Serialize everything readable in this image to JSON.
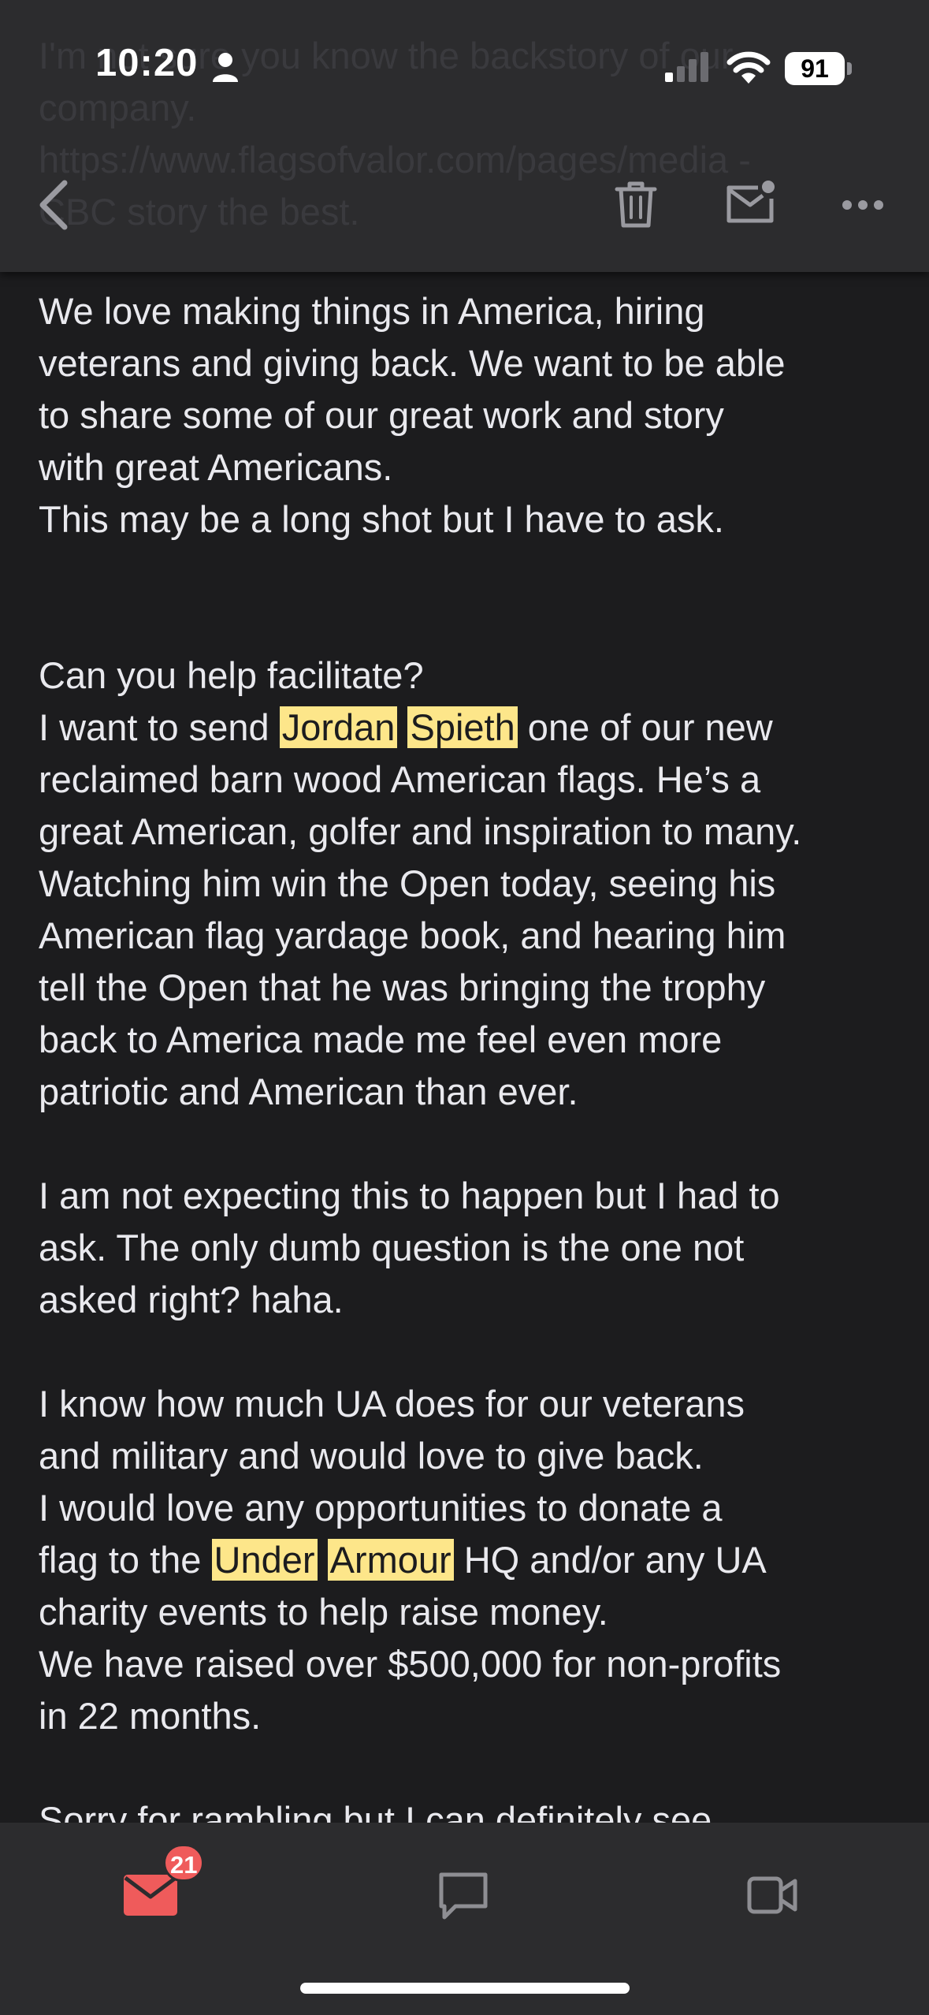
{
  "status_bar": {
    "time": "10:20",
    "battery": "91"
  },
  "header": {
    "ghost_lines": [
      "I'm not sure you know the backstory of our",
      "company.",
      "https://www.flagsofvalor.com/pages/media -",
      "CBC story the best."
    ],
    "icons": [
      "back-chevron-icon",
      "trash-icon",
      "mark-unread-icon",
      "more-icon"
    ]
  },
  "email": {
    "lines": [
      "We love making things in America, hiring",
      "veterans and giving back. We want to be able",
      "to share some of our great work and story",
      "with great Americans.",
      "This may be a long shot but I have to ask.",
      "",
      "",
      "Can you help facilitate?",
      [
        "I want to send ",
        {
          "hl": "Jordan"
        },
        " ",
        {
          "hl": "Spieth"
        },
        " one of our new"
      ],
      "reclaimed barn wood American flags. He’s a",
      "great American, golfer and inspiration to many.",
      " Watching him win the Open today, seeing his",
      "American flag yardage book, and hearing him",
      "tell the Open that he was bringing the trophy",
      "back to America made me feel even more",
      "patriotic and American than ever.",
      "",
      "I am not expecting this to happen but I had to",
      "ask.  The only dumb question is the one not",
      "asked right? haha.",
      "",
      "I know how much UA does for our veterans",
      "and military and would love to give back.",
      "I would  love any opportunities to donate a",
      [
        "flag to the ",
        {
          "hl": "Under"
        },
        " ",
        {
          "hl": "Armour"
        },
        " HQ and/or any UA"
      ],
      "charity events to help raise money.",
      "We have raised over $500,000 for non-profits",
      "in 22 months.",
      "",
      "Sorry for rambling but I can definitely see"
    ]
  },
  "tabbar": {
    "mail_badge": "21",
    "tabs": [
      "mail-icon",
      "chat-icon",
      "video-icon"
    ]
  },
  "colors": {
    "background": "#1c1c1e",
    "bar": "#2c2c2e",
    "highlight": "#fde68a",
    "accent": "#ef5b5b"
  }
}
